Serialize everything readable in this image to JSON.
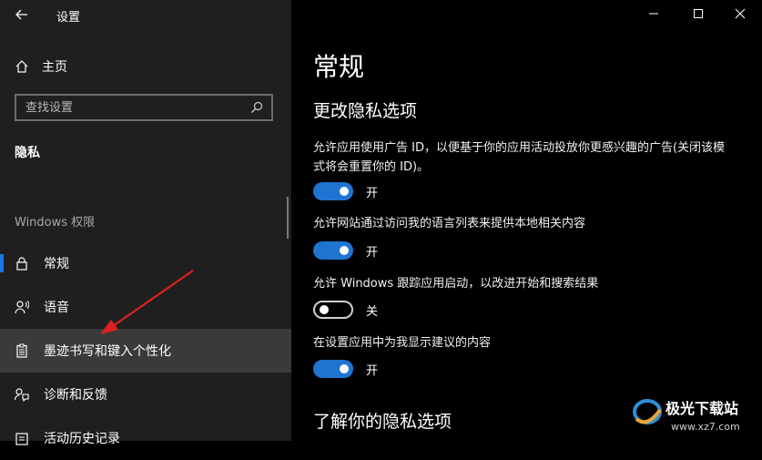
{
  "window": {
    "title": "设置",
    "controls": [
      "minimize-icon",
      "maximize-icon",
      "close-icon"
    ]
  },
  "sidebar": {
    "home_label": "主页",
    "search": {
      "placeholder": "查找设置",
      "value": ""
    },
    "section_title": "隐私",
    "group_title": "Windows 权限",
    "items": [
      {
        "label": "常规",
        "icon": "lock-icon",
        "selected": true
      },
      {
        "label": "语音",
        "icon": "voice-icon",
        "selected": false
      },
      {
        "label": "墨迹书写和键入个性化",
        "icon": "clipboard-icon",
        "selected": false,
        "hovered": true
      },
      {
        "label": "诊断和反馈",
        "icon": "feedback-icon",
        "selected": false
      },
      {
        "label": "活动历史记录",
        "icon": "history-icon",
        "selected": false
      }
    ]
  },
  "main": {
    "page_title": "常规",
    "sub_title": "更改隐私选项",
    "settings": [
      {
        "desc": "允许应用使用广告 ID，以便基于你的应用活动投放你更感兴趣的广告(关闭该模式将会重置你的 ID)。",
        "state": "开",
        "on": true
      },
      {
        "desc": "允许网站通过访问我的语言列表来提供本地相关内容",
        "state": "开",
        "on": true
      },
      {
        "desc": "允许 Windows 跟踪应用启动，以改进开始和搜索结果",
        "state": "关",
        "on": false
      },
      {
        "desc": "在设置应用中为我显示建议的内容",
        "state": "开",
        "on": true
      }
    ],
    "learn_title": "了解你的隐私选项"
  },
  "watermark": {
    "brand": "极光下载站",
    "url": "www.xz7.com"
  },
  "colors": {
    "accent": "#1f74d1",
    "sidebar_bg": "#1f1f1f",
    "hover_bg": "#3a3a3a",
    "arrow": "#e02020"
  }
}
